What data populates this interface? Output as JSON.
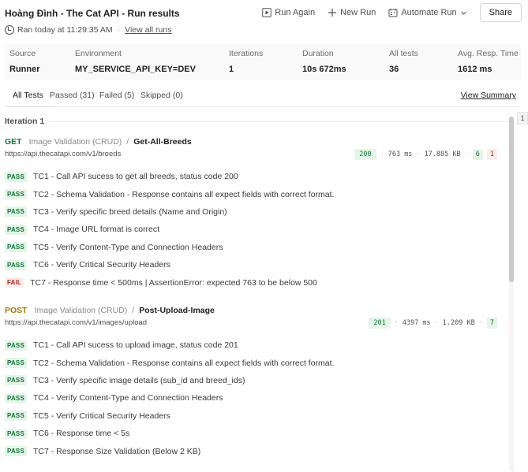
{
  "header": {
    "title": "Hoàng Đình - The Cat API - Run results",
    "ran_text": "Ran today at 11:29:35 AM",
    "separator": "·",
    "view_all_runs": "View all runs"
  },
  "toolbar": {
    "run_again": "Run Again",
    "new_run": "New Run",
    "automate_run": "Automate Run",
    "share": "Share"
  },
  "stats": {
    "source_label": "Source",
    "source_value": "Runner",
    "environment_label": "Environment",
    "environment_value": "MY_SERVICE_API_KEY=DEV",
    "iterations_label": "Iterations",
    "iterations_value": "1",
    "duration_label": "Duration",
    "duration_value": "10s 672ms",
    "all_tests_label": "All tests",
    "all_tests_value": "36",
    "avg_label": "Avg. Resp. Time",
    "avg_value": "1612 ms"
  },
  "tabs": {
    "all": "All Tests",
    "passed": "Passed (31)",
    "failed": "Failed (5)",
    "skipped": "Skipped (0)",
    "view_summary": "View Summary"
  },
  "iteration": {
    "label": "Iteration 1",
    "counter": "1"
  },
  "requests": [
    {
      "method": "GET",
      "folder": "Image Validation (CRUD)",
      "slash": "/",
      "name": "Get-All-Breeds",
      "url": "https://api.thecatapi.com/v1/breeds",
      "status": "200",
      "dot": "·",
      "time": "763 ms",
      "size": "17.885 KB",
      "passed": "6",
      "failed": "1",
      "tests": [
        {
          "status": "PASS",
          "name": "TC1 - Call API sucess to get all breeds, status code 200"
        },
        {
          "status": "PASS",
          "name": "TC2 - Schema Validation - Response contains all expect fields with correct format."
        },
        {
          "status": "PASS",
          "name": "TC3 - Verify specific breed details (Name and Origin)"
        },
        {
          "status": "PASS",
          "name": "TC4 - Image URL format is correct"
        },
        {
          "status": "PASS",
          "name": "TC5 - Verify Content-Type and Connection Headers"
        },
        {
          "status": "PASS",
          "name": "TC6 - Verify Critical Security Headers"
        },
        {
          "status": "FAIL",
          "name": "TC7 - Response time < 500ms | AssertionError: expected 763 to be below 500"
        }
      ]
    },
    {
      "method": "POST",
      "folder": "Image Validation (CRUD)",
      "slash": "/",
      "name": "Post-Upload-Image",
      "url": "https://api.thecatapi.com/v1/images/upload",
      "status": "201",
      "dot": "·",
      "time": "4397 ms",
      "size": "1.209 KB",
      "passed": "7",
      "tests": [
        {
          "status": "PASS",
          "name": "TC1 - Call API sucess to upload image, status code 201"
        },
        {
          "status": "PASS",
          "name": "TC2 - Schema Validation - Response contains all expect fields with correct format."
        },
        {
          "status": "PASS",
          "name": "TC3 - Verify specific image details (sub_id and breed_ids)"
        },
        {
          "status": "PASS",
          "name": "TC4 - Verify Content-Type and Connection Headers"
        },
        {
          "status": "PASS",
          "name": "TC5 - Verify Critical Security Headers"
        },
        {
          "status": "PASS",
          "name": "TC6 - Response time < 5s"
        },
        {
          "status": "PASS",
          "name": "TC7 - Response Size Validation (Below 2 KB)"
        }
      ]
    }
  ],
  "icons": {
    "ran": "history-icon",
    "run_again": "play-icon",
    "new_run": "plus-icon",
    "automate_run": "automate-icon",
    "dropdown": "chevron-down-icon"
  },
  "colors": {
    "get": "#007f31",
    "post": "#ad7a03",
    "pass_bg": "#e6f4ea",
    "fail_bg": "#fdecea"
  }
}
